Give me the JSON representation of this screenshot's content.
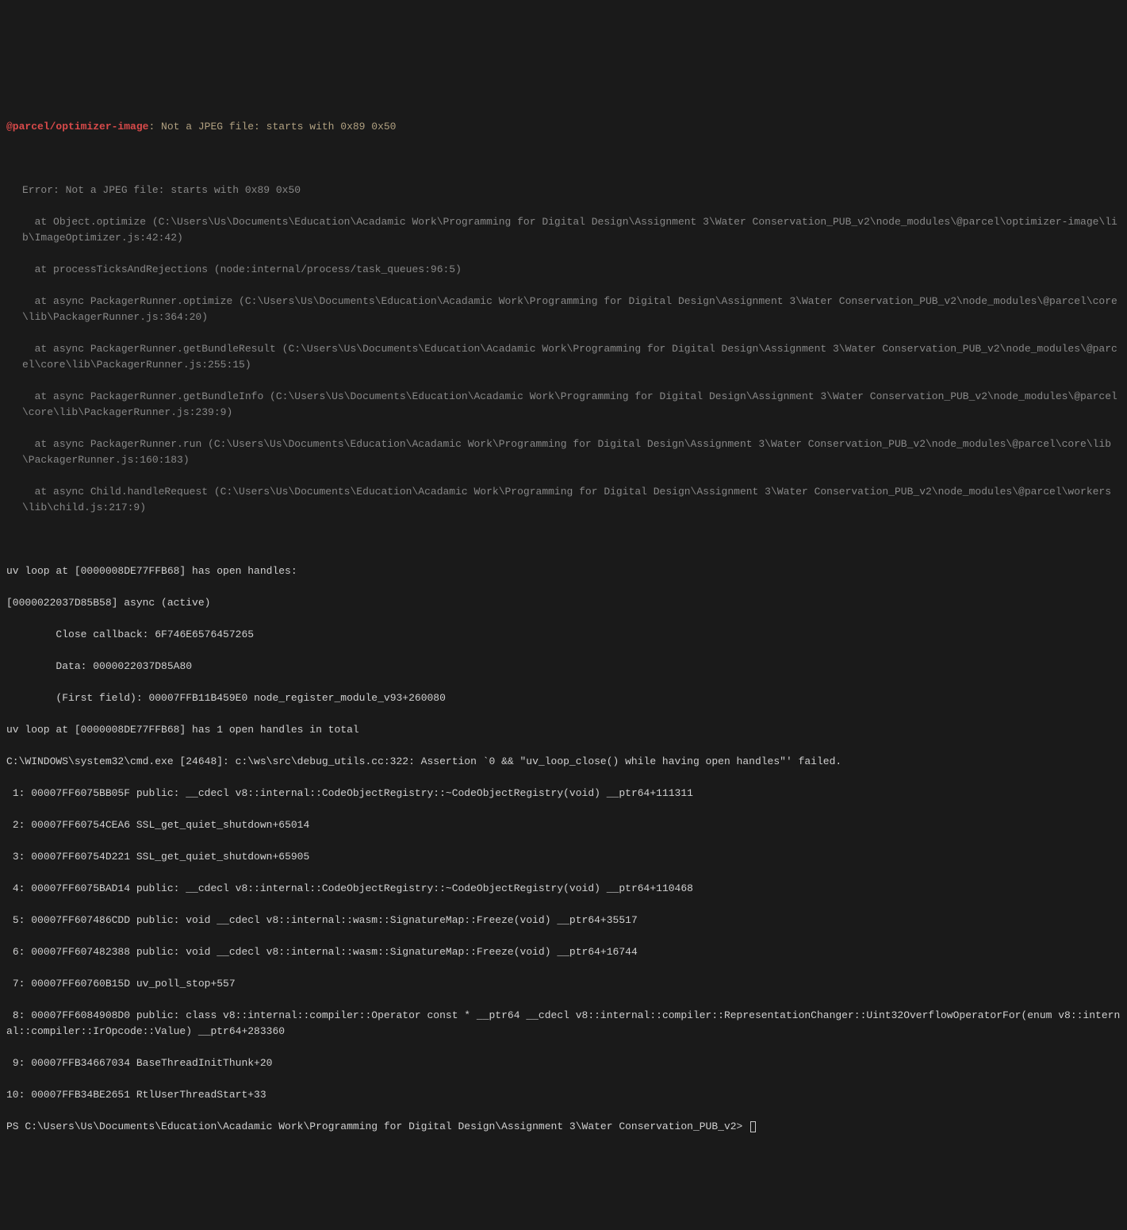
{
  "error": {
    "prefix": "@parcel/optimizer-image",
    "message": ": Not a JPEG file: starts with 0x89 0x50"
  },
  "stack": [
    "Error: Not a JPEG file: starts with 0x89 0x50",
    "  at Object.optimize (C:\\Users\\Us\\Documents\\Education\\Acadamic Work\\Programming for Digital Design\\Assignment 3\\Water Conservation_PUB_v2\\node_modules\\@parcel\\optimizer-image\\lib\\ImageOptimizer.js:42:42)",
    "  at processTicksAndRejections (node:internal/process/task_queues:96:5)",
    "  at async PackagerRunner.optimize (C:\\Users\\Us\\Documents\\Education\\Acadamic Work\\Programming for Digital Design\\Assignment 3\\Water Conservation_PUB_v2\\node_modules\\@parcel\\core\\lib\\PackagerRunner.js:364:20)",
    "  at async PackagerRunner.getBundleResult (C:\\Users\\Us\\Documents\\Education\\Acadamic Work\\Programming for Digital Design\\Assignment 3\\Water Conservation_PUB_v2\\node_modules\\@parcel\\core\\lib\\PackagerRunner.js:255:15)",
    "  at async PackagerRunner.getBundleInfo (C:\\Users\\Us\\Documents\\Education\\Acadamic Work\\Programming for Digital Design\\Assignment 3\\Water Conservation_PUB_v2\\node_modules\\@parcel\\core\\lib\\PackagerRunner.js:239:9)",
    "  at async PackagerRunner.run (C:\\Users\\Us\\Documents\\Education\\Acadamic Work\\Programming for Digital Design\\Assignment 3\\Water Conservation_PUB_v2\\node_modules\\@parcel\\core\\lib\\PackagerRunner.js:160:183)",
    "  at async Child.handleRequest (C:\\Users\\Us\\Documents\\Education\\Acadamic Work\\Programming for Digital Design\\Assignment 3\\Water Conservation_PUB_v2\\node_modules\\@parcel\\workers\\lib\\child.js:217:9)"
  ],
  "uvloop": [
    "uv loop at [0000008DE77FFB68] has open handles:",
    "[0000022037D85B58] async (active)",
    "        Close callback: 6F746E6576457265",
    "        Data: 0000022037D85A80",
    "        (First field): 00007FFB11B459E0 node_register_module_v93+260080",
    "uv loop at [0000008DE77FFB68] has 1 open handles in total",
    "C:\\WINDOWS\\system32\\cmd.exe [24648]: c:\\ws\\src\\debug_utils.cc:322: Assertion `0 && \"uv_loop_close() while having open handles\"' failed.",
    " 1: 00007FF6075BB05F public: __cdecl v8::internal::CodeObjectRegistry::~CodeObjectRegistry(void) __ptr64+111311",
    " 2: 00007FF60754CEA6 SSL_get_quiet_shutdown+65014",
    " 3: 00007FF60754D221 SSL_get_quiet_shutdown+65905",
    " 4: 00007FF6075BAD14 public: __cdecl v8::internal::CodeObjectRegistry::~CodeObjectRegistry(void) __ptr64+110468",
    " 5: 00007FF607486CDD public: void __cdecl v8::internal::wasm::SignatureMap::Freeze(void) __ptr64+35517",
    " 6: 00007FF607482388 public: void __cdecl v8::internal::wasm::SignatureMap::Freeze(void) __ptr64+16744",
    " 7: 00007FF60760B15D uv_poll_stop+557",
    " 8: 00007FF6084908D0 public: class v8::internal::compiler::Operator const * __ptr64 __cdecl v8::internal::compiler::RepresentationChanger::Uint32OverflowOperatorFor(enum v8::internal::compiler::IrOpcode::Value) __ptr64+283360",
    " 9: 00007FFB34667034 BaseThreadInitThunk+20",
    "10: 00007FFB34BE2651 RtlUserThreadStart+33"
  ],
  "prompt": "PS C:\\Users\\Us\\Documents\\Education\\Acadamic Work\\Programming for Digital Design\\Assignment 3\\Water Conservation_PUB_v2> "
}
